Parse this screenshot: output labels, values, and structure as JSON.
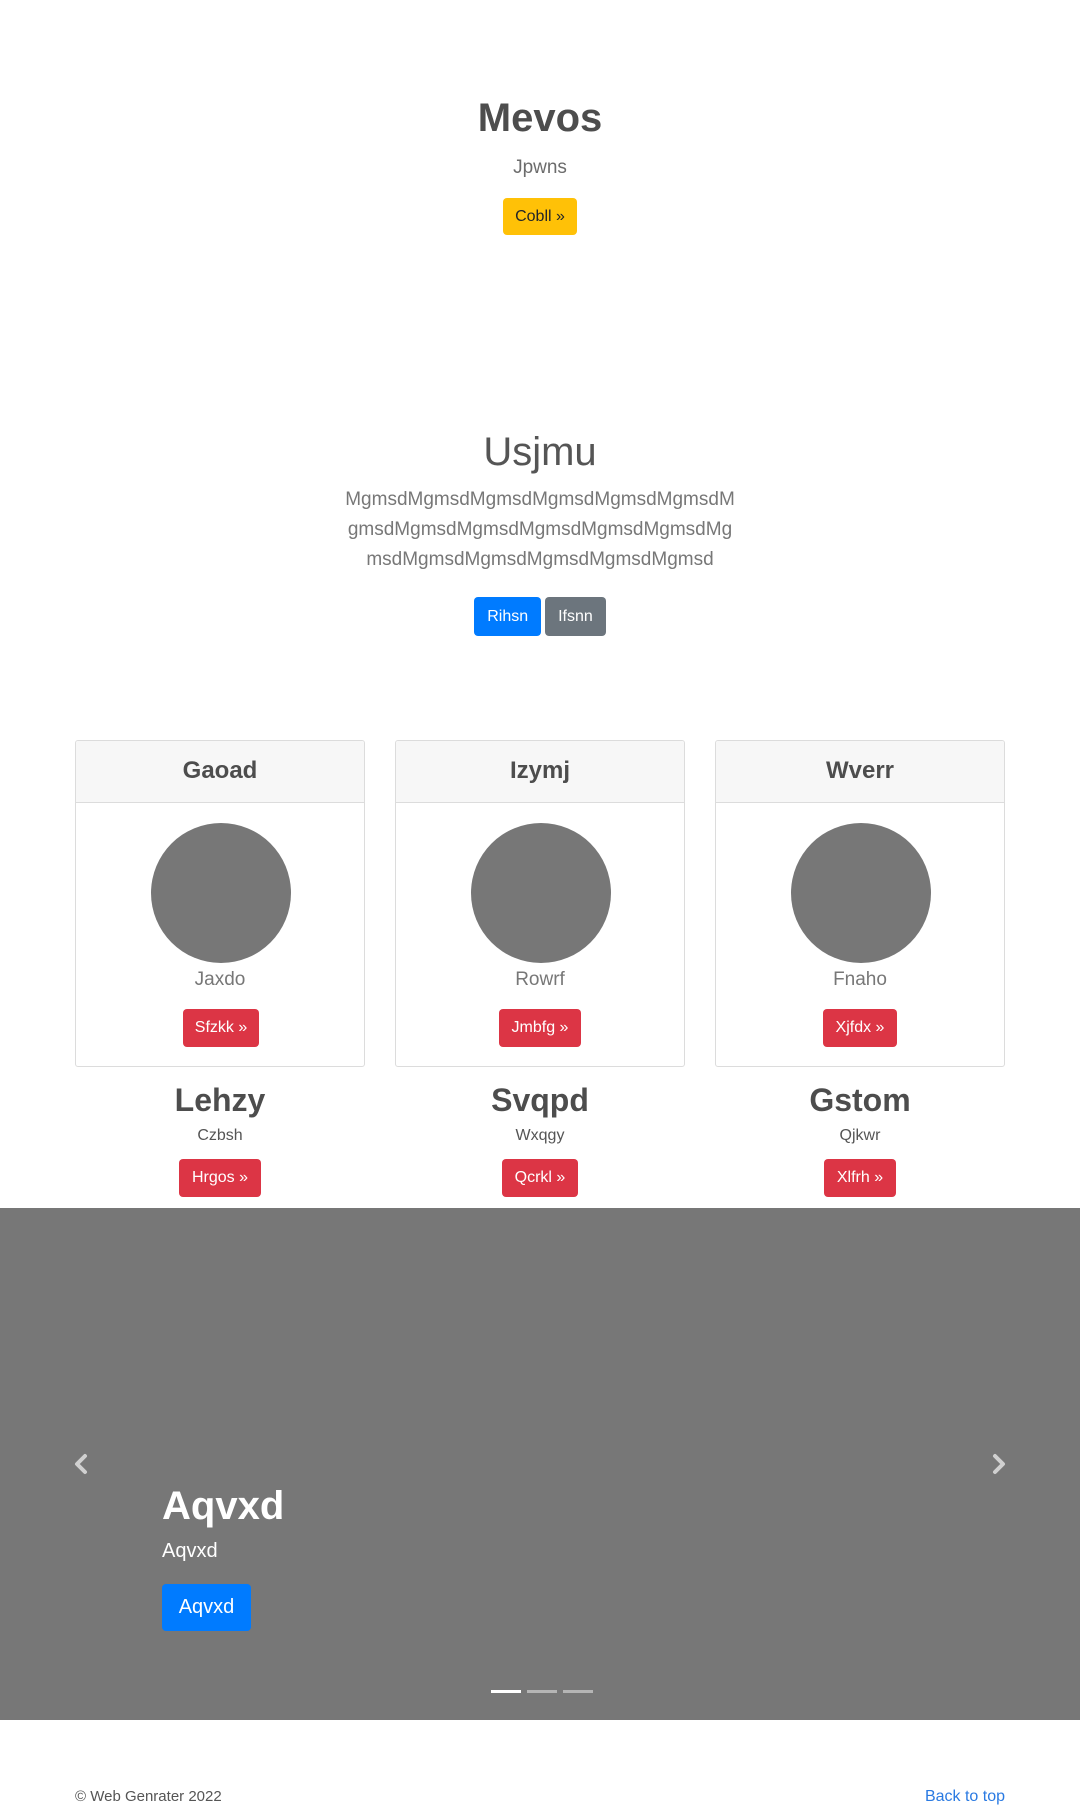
{
  "hero": {
    "title": "Mevos",
    "subtitle": "Jpwns",
    "button": "Cobll »"
  },
  "intro": {
    "heading": "Usjmu",
    "paragraph": "MgmsdMgmsdMgmsdMgmsdMgmsdMgmsdMgmsdMgmsdMgmsdMgmsdMgmsdMgmsdMgmsdMgmsdMgmsdMgmsdMgmsdMgmsd",
    "primary_button": "Rihsn",
    "secondary_button": "Ifsnn"
  },
  "cards": [
    {
      "header": "Gaoad",
      "name": "Jaxdo",
      "button": "Sfzkk »"
    },
    {
      "header": "Izymj",
      "name": "Rowrf",
      "button": "Jmbfg »"
    },
    {
      "header": "Wverr",
      "name": "Fnaho",
      "button": "Xjfdx »"
    }
  ],
  "features": [
    {
      "title": "Lehzy",
      "text": "Czbsh",
      "button": "Hrgos »"
    },
    {
      "title": "Svqpd",
      "text": "Wxqgy",
      "button": "Qcrkl »"
    },
    {
      "title": "Gstom",
      "text": "Qjkwr",
      "button": "Xlfrh »"
    }
  ],
  "carousel": {
    "title": "Aqvxd",
    "caption": "Aqvxd",
    "button": "Aqvxd",
    "prev_icon": "chevron-left-icon",
    "next_icon": "chevron-right-icon",
    "slide_count": 3,
    "active_slide": 1
  },
  "footer": {
    "copyright": "© Web Genrater 2022",
    "back_to_top": "Back to top"
  },
  "colors": {
    "warning": "#ffc107",
    "primary": "#007bff",
    "secondary": "#6c757d",
    "danger": "#dc3545",
    "placeholder_gray": "#777777",
    "link": "#2a7ae2"
  }
}
